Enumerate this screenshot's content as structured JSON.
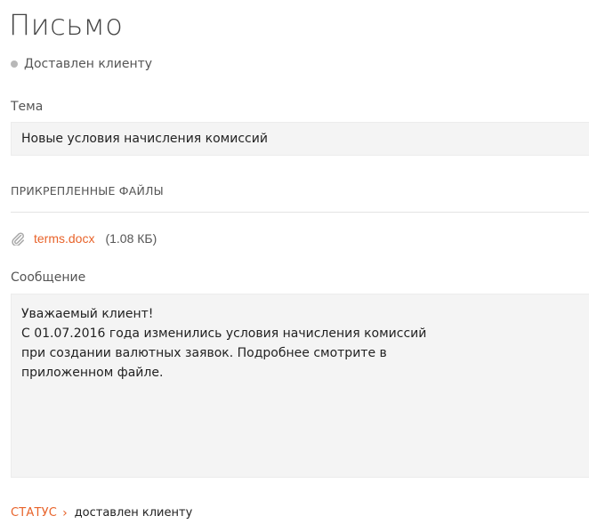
{
  "header": {
    "title": "Письмо",
    "status": "Доставлен клиенту"
  },
  "subject": {
    "label": "Тема",
    "value": "Новые условия начисления комиссий"
  },
  "attachments": {
    "section_title": "ПРИКРЕПЛЕННЫЕ ФАЙЛЫ",
    "files": [
      {
        "name": "terms.docx",
        "size": "(1.08 КБ)"
      }
    ]
  },
  "message": {
    "label": "Сообщение",
    "value": "Уважаемый клиент!\nС 01.07.2016 года изменились условия начисления комиссий\nпри создании валютных заявок. Подробнее смотрите в\nприложенном файле."
  },
  "footer": {
    "status_label": "СТАТУС",
    "status_value": "доставлен клиенту"
  },
  "colors": {
    "accent": "#e8632a",
    "status_dot": "#b8b8b8",
    "field_bg": "#f4f4f4"
  },
  "icons": {
    "status": "dot-icon",
    "attachment": "paperclip-icon",
    "chevron": "chevron-right-icon"
  }
}
